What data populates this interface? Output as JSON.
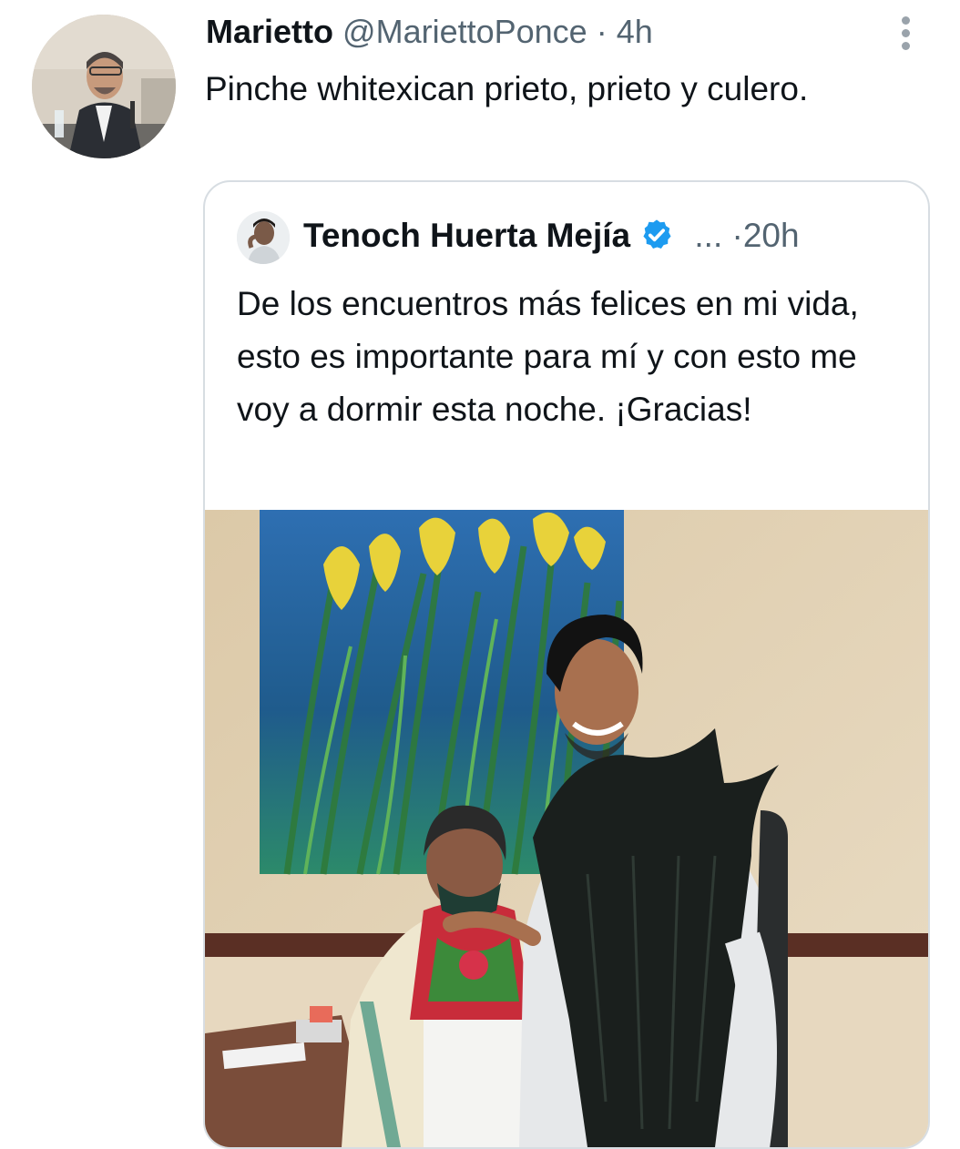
{
  "tweet": {
    "author_name": "Marietto",
    "author_handle": "@MariettoPonce",
    "separator": "·",
    "time": "4h",
    "text": "Pinche whitexican prieto, prieto y culero.",
    "more_icon": "more-vertical-icon"
  },
  "quoted_tweet": {
    "author_name": "Tenoch Huerta Mejía",
    "verified_icon": "verified-badge-icon",
    "ellipsis": "...",
    "separator": "·",
    "time": "20h",
    "text": "De los encuentros más felices en mi vida, esto es importante para mí y con esto me voy a dormir esta noche. ¡Gracias!"
  },
  "colors": {
    "text_primary": "#0f1419",
    "text_secondary": "#536471",
    "border": "#d7dde2",
    "verified_blue": "#1d9bf0"
  }
}
